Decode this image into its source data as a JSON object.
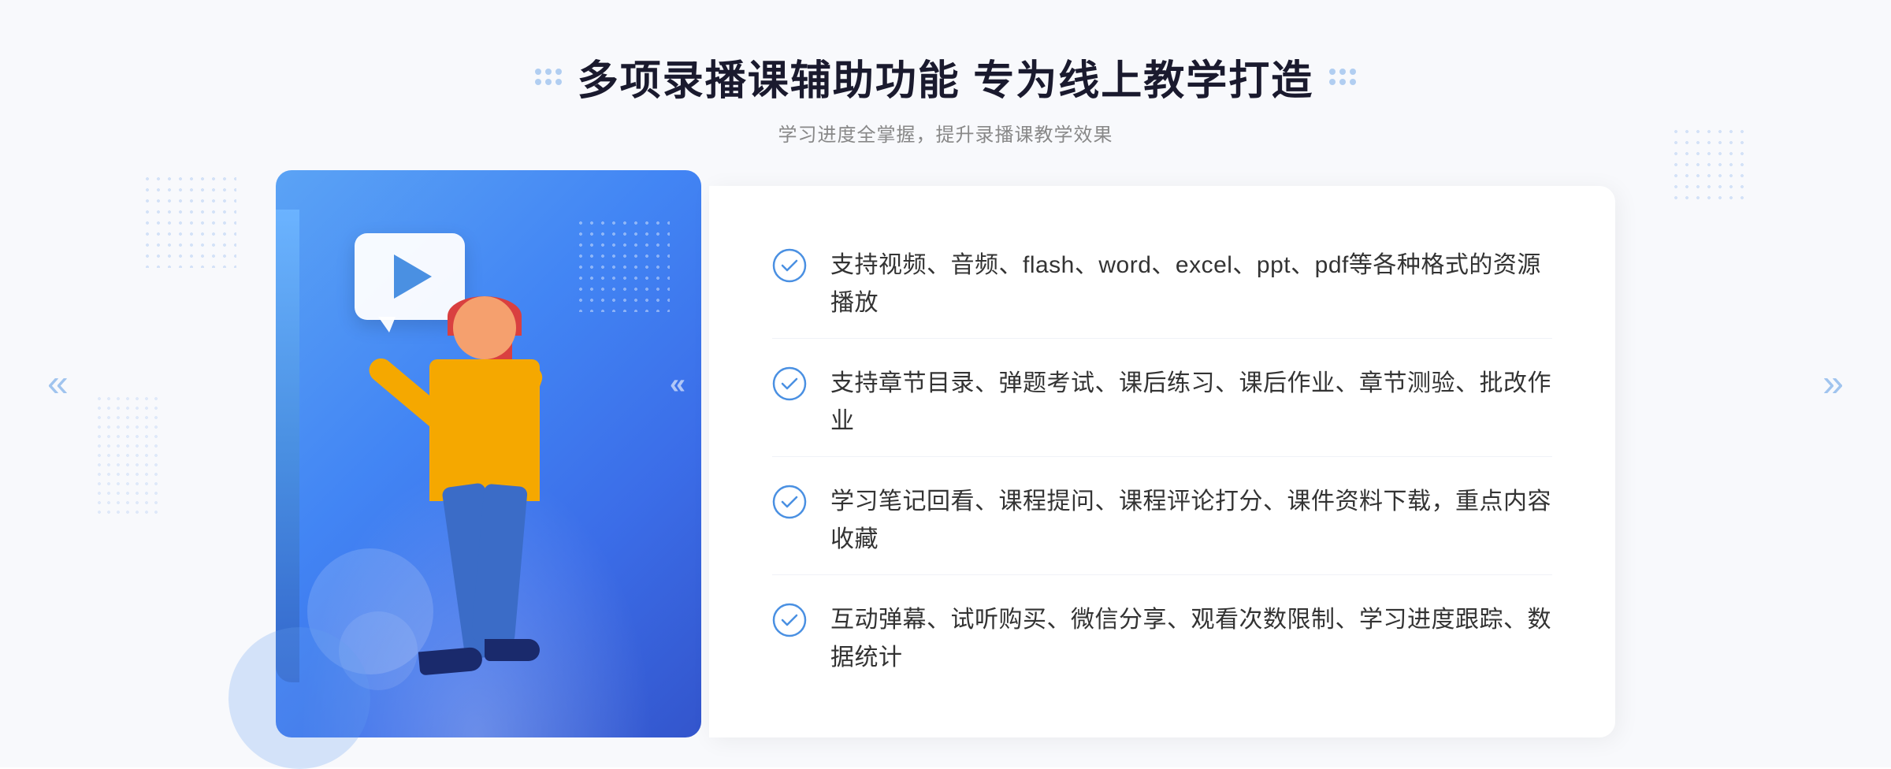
{
  "header": {
    "title": "多项录播课辅助功能 专为线上教学打造",
    "subtitle": "学习进度全掌握，提升录播课教学效果",
    "decoration_dots_count": 6
  },
  "features": [
    {
      "id": 1,
      "text": "支持视频、音频、flash、word、excel、ppt、pdf等各种格式的资源播放"
    },
    {
      "id": 2,
      "text": "支持章节目录、弹题考试、课后练习、课后作业、章节测验、批改作业"
    },
    {
      "id": 3,
      "text": "学习笔记回看、课程提问、课程评论打分、课件资料下载，重点内容收藏"
    },
    {
      "id": 4,
      "text": "互动弹幕、试听购买、微信分享、观看次数限制、学习进度跟踪、数据统计"
    }
  ],
  "colors": {
    "primary": "#4a90e2",
    "primary_dark": "#3355cc",
    "text_dark": "#1a1a2e",
    "text_gray": "#888888",
    "text_body": "#333333",
    "check_color": "#4a90e2",
    "bg_light": "#f8f9fc"
  },
  "navigation": {
    "prev_arrow": "«",
    "next_arrow": "»"
  }
}
